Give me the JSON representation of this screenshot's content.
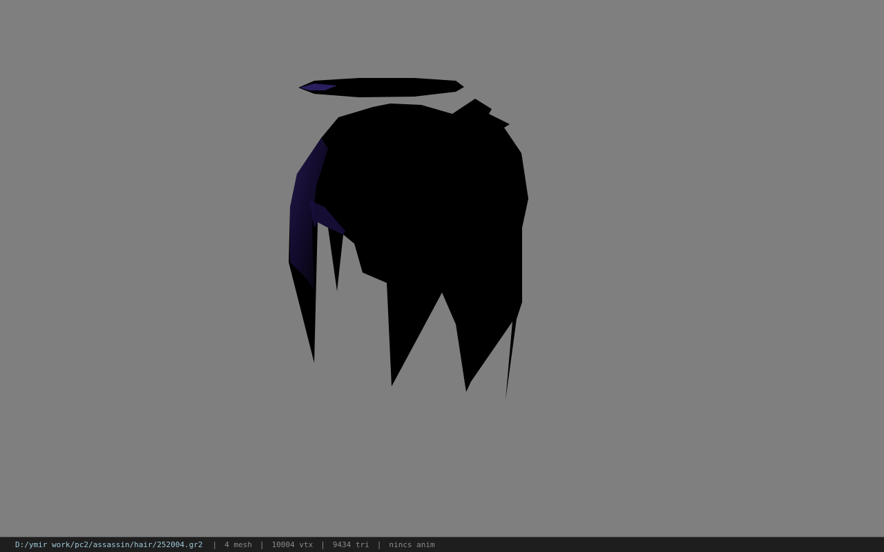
{
  "viewport": {
    "background": "#7f7f7f",
    "model": "hair-mesh"
  },
  "statusbar": {
    "file_path": "D:/ymir work/pc2/assassin/hair/252004.gr2",
    "mesh_count": "4 mesh",
    "vertex_count": "10004 vtx",
    "triangle_count": "9434 tri",
    "anim_status": "nincs anim",
    "separator": "|"
  }
}
